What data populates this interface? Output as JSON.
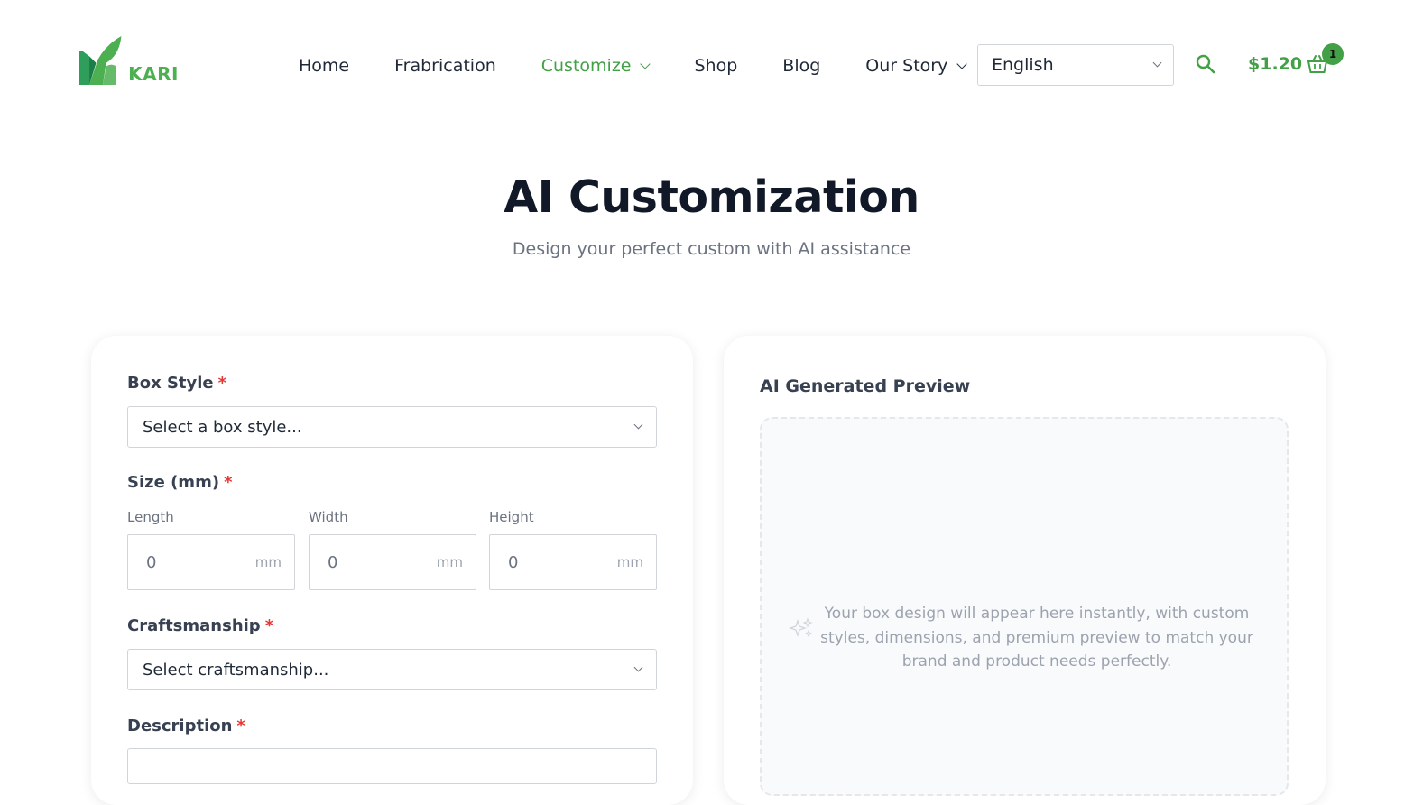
{
  "brand": {
    "name": "KARI",
    "accent": "#43a047"
  },
  "nav": {
    "items": [
      {
        "label": "Home"
      },
      {
        "label": "Frabrication"
      },
      {
        "label": "Customize",
        "active": true,
        "dropdown": true
      },
      {
        "label": "Shop"
      },
      {
        "label": "Blog"
      },
      {
        "label": "Our Story",
        "dropdown": true
      }
    ],
    "language": "English",
    "cart_total": "$1.20",
    "cart_count": "1",
    "icons": [
      "search-icon",
      "basket-icon",
      "chevron-down-icon"
    ]
  },
  "hero": {
    "title": "AI Customization",
    "subtitle": "Design your perfect custom with AI assistance"
  },
  "form": {
    "box_style": {
      "label": "Box Style",
      "required": "*",
      "placeholder": "Select a box style..."
    },
    "size": {
      "label": "Size (mm)",
      "required": "*",
      "length": {
        "label": "Length",
        "value": "0",
        "unit": "mm"
      },
      "width": {
        "label": "Width",
        "value": "0",
        "unit": "mm"
      },
      "height": {
        "label": "Height",
        "value": "0",
        "unit": "mm"
      }
    },
    "craftsmanship": {
      "label": "Craftsmanship",
      "required": "*",
      "placeholder": "Select craftsmanship..."
    },
    "description": {
      "label": "Description",
      "required": "*"
    }
  },
  "preview": {
    "title": "AI Generated Preview",
    "placeholder": "Your box design will appear here instantly, with custom styles, dimensions, and premium preview to match your brand and product needs perfectly."
  }
}
